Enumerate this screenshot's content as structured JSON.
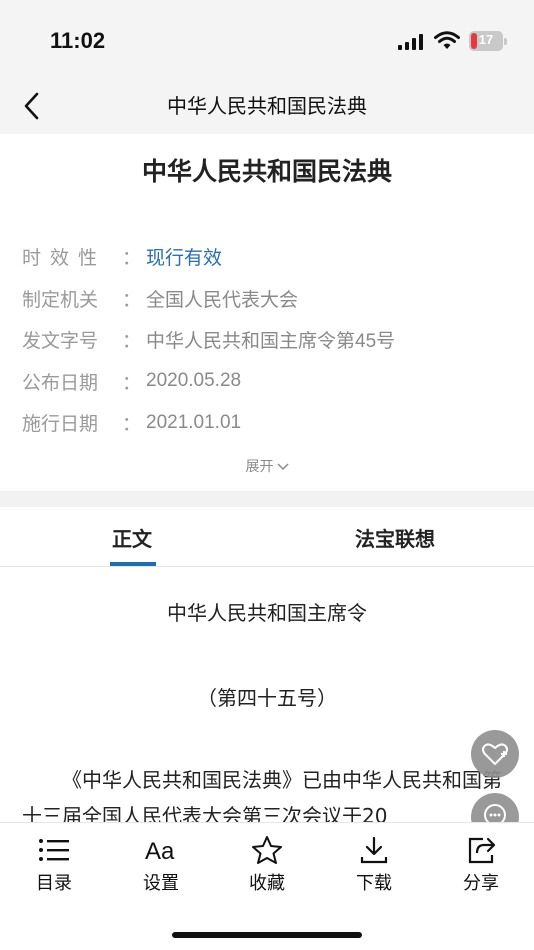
{
  "status_bar": {
    "time": "11:02",
    "battery": "17"
  },
  "nav": {
    "title": "中华人民共和国民法典"
  },
  "document": {
    "title": "中华人民共和国民法典",
    "meta": [
      {
        "label": "时效性",
        "value": "现行有效"
      },
      {
        "label": "制定机关",
        "value": "全国人民代表大会"
      },
      {
        "label": "发文字号",
        "value": "中华人民共和国主席令第45号"
      },
      {
        "label": "公布日期",
        "value": "2020.05.28"
      },
      {
        "label": "施行日期",
        "value": "2021.01.01"
      }
    ],
    "colon": "：",
    "expand_label": "展开"
  },
  "tabs": [
    {
      "label": "正文",
      "active": true
    },
    {
      "label": "法宝联想",
      "active": false
    }
  ],
  "content": {
    "heading": "中华人民共和国主席令",
    "number": "（第四十五号）",
    "paragraph": "《中华人民共和国民法典》已由中华人民共和国第十三届全国人民代表大会第三次会议于20"
  },
  "toolbar": [
    {
      "label": "目录",
      "icon": "list-icon"
    },
    {
      "label": "设置",
      "icon": "font-size-icon"
    },
    {
      "label": "收藏",
      "icon": "star-icon"
    },
    {
      "label": "下载",
      "icon": "download-icon"
    },
    {
      "label": "分享",
      "icon": "share-icon"
    }
  ],
  "colors": {
    "accent": "#1e6fa8",
    "status_value": "#2a6fb0",
    "nav_bg": "#f4f4f4"
  }
}
